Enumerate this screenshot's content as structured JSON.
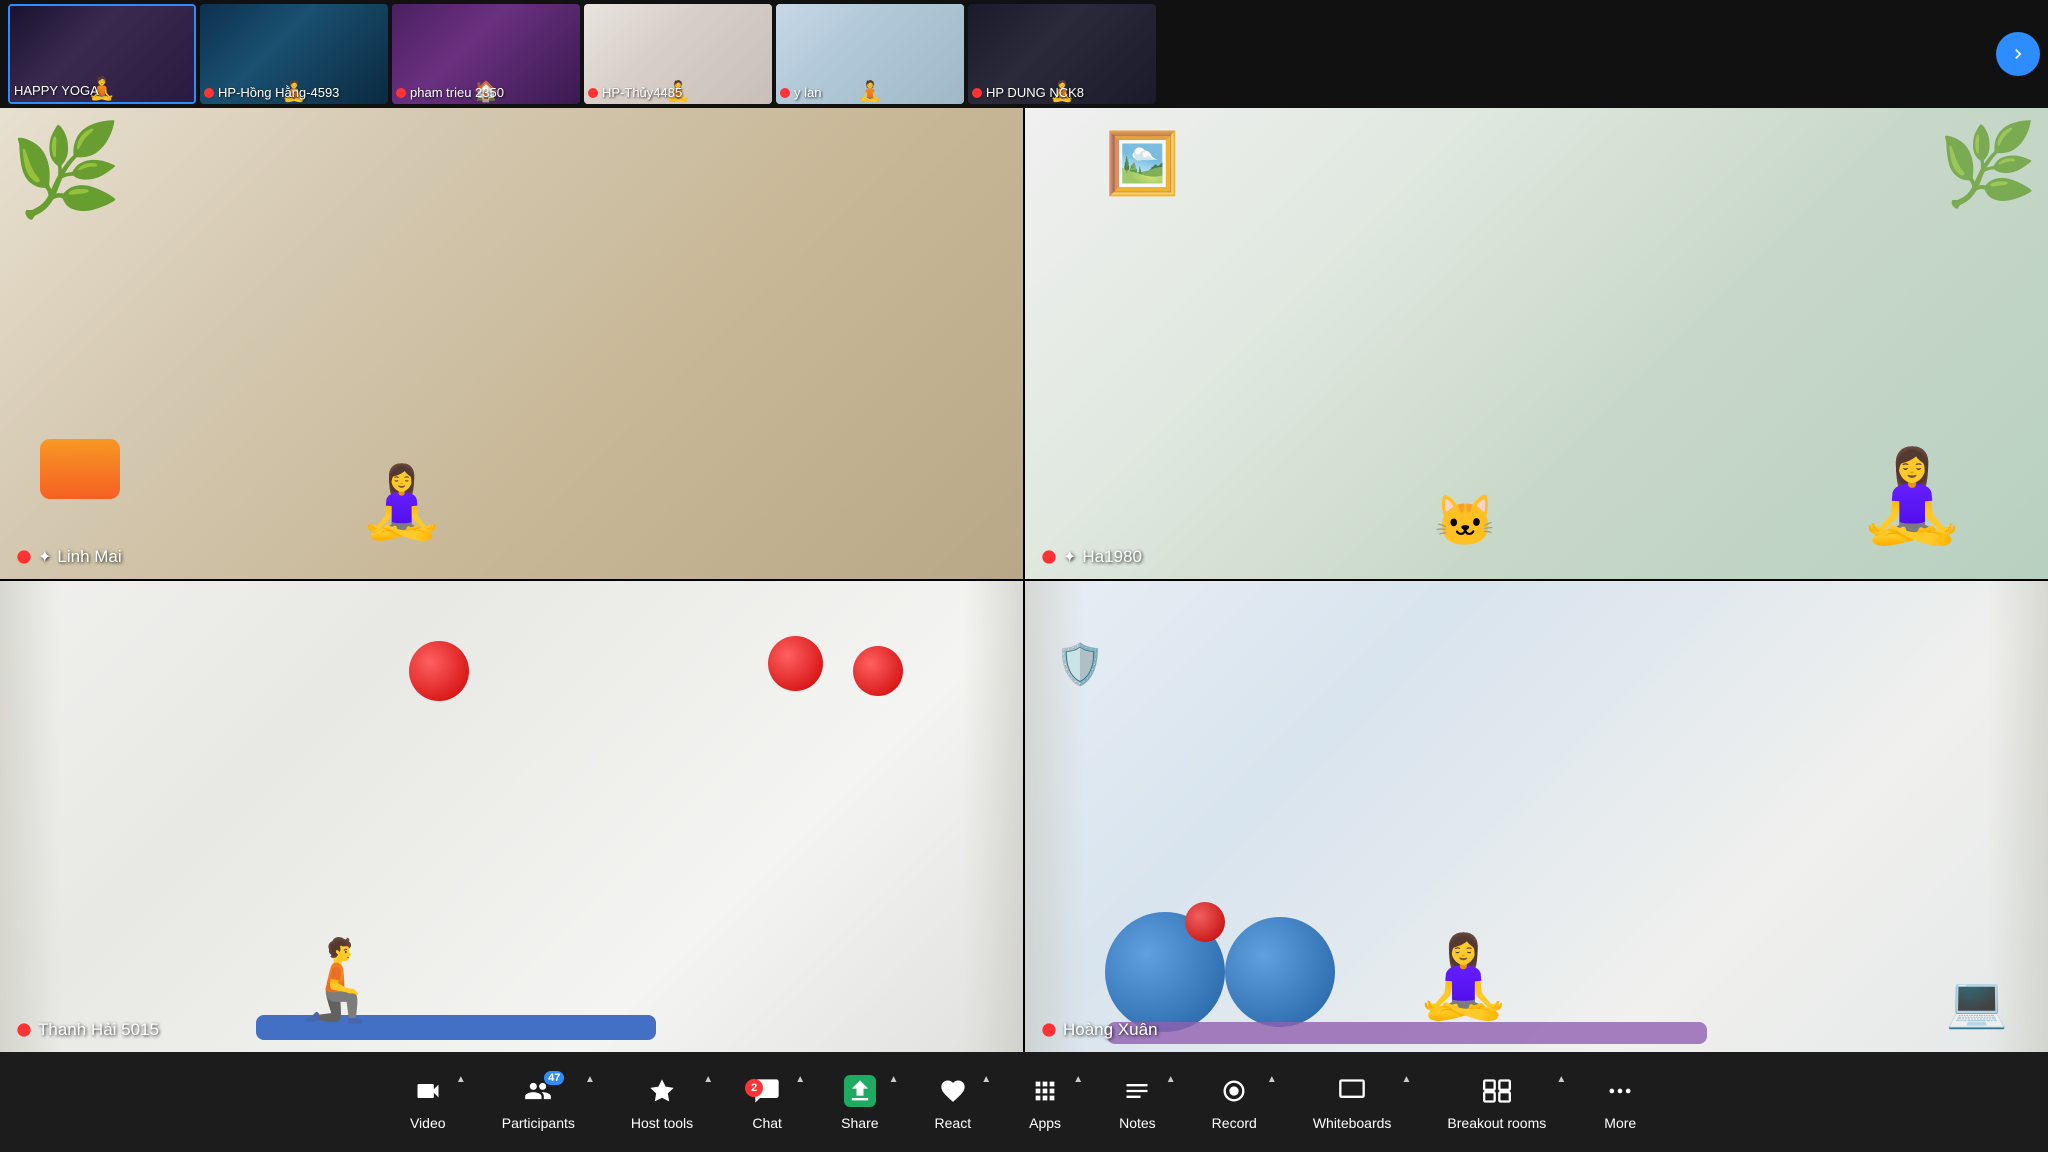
{
  "thumbnails": [
    {
      "id": 0,
      "label": "HAPPY YOGA",
      "active": true,
      "muted": false
    },
    {
      "id": 1,
      "label": "HP-Hồng Hằng-4593",
      "active": false,
      "muted": true
    },
    {
      "id": 2,
      "label": "pham trieu 2350",
      "active": false,
      "muted": true
    },
    {
      "id": 3,
      "label": "HP-Thủy4485",
      "active": false,
      "muted": true
    },
    {
      "id": 4,
      "label": "y lan",
      "active": false,
      "muted": true
    },
    {
      "id": 5,
      "label": "HP DUNG NCK8",
      "active": false,
      "muted": true
    }
  ],
  "participants_count": "47",
  "videos": [
    {
      "id": 0,
      "name": "Linh Mai",
      "muted": true,
      "pinned": true
    },
    {
      "id": 1,
      "name": "Ha1980",
      "muted": true,
      "pinned": true
    },
    {
      "id": 2,
      "name": "Thanh Hải 5015",
      "muted": true,
      "pinned": false
    },
    {
      "id": 3,
      "name": "Hoàng Xuân",
      "muted": true,
      "pinned": false
    }
  ],
  "toolbar": {
    "video_label": "Video",
    "participants_label": "Participants",
    "host_tools_label": "Host tools",
    "chat_label": "Chat",
    "chat_badge": "2",
    "share_label": "Share",
    "react_label": "React",
    "apps_label": "Apps",
    "notes_label": "Notes",
    "record_label": "Record",
    "whiteboards_label": "Whiteboards",
    "breakout_label": "Breakout rooms",
    "more_label": "More"
  }
}
